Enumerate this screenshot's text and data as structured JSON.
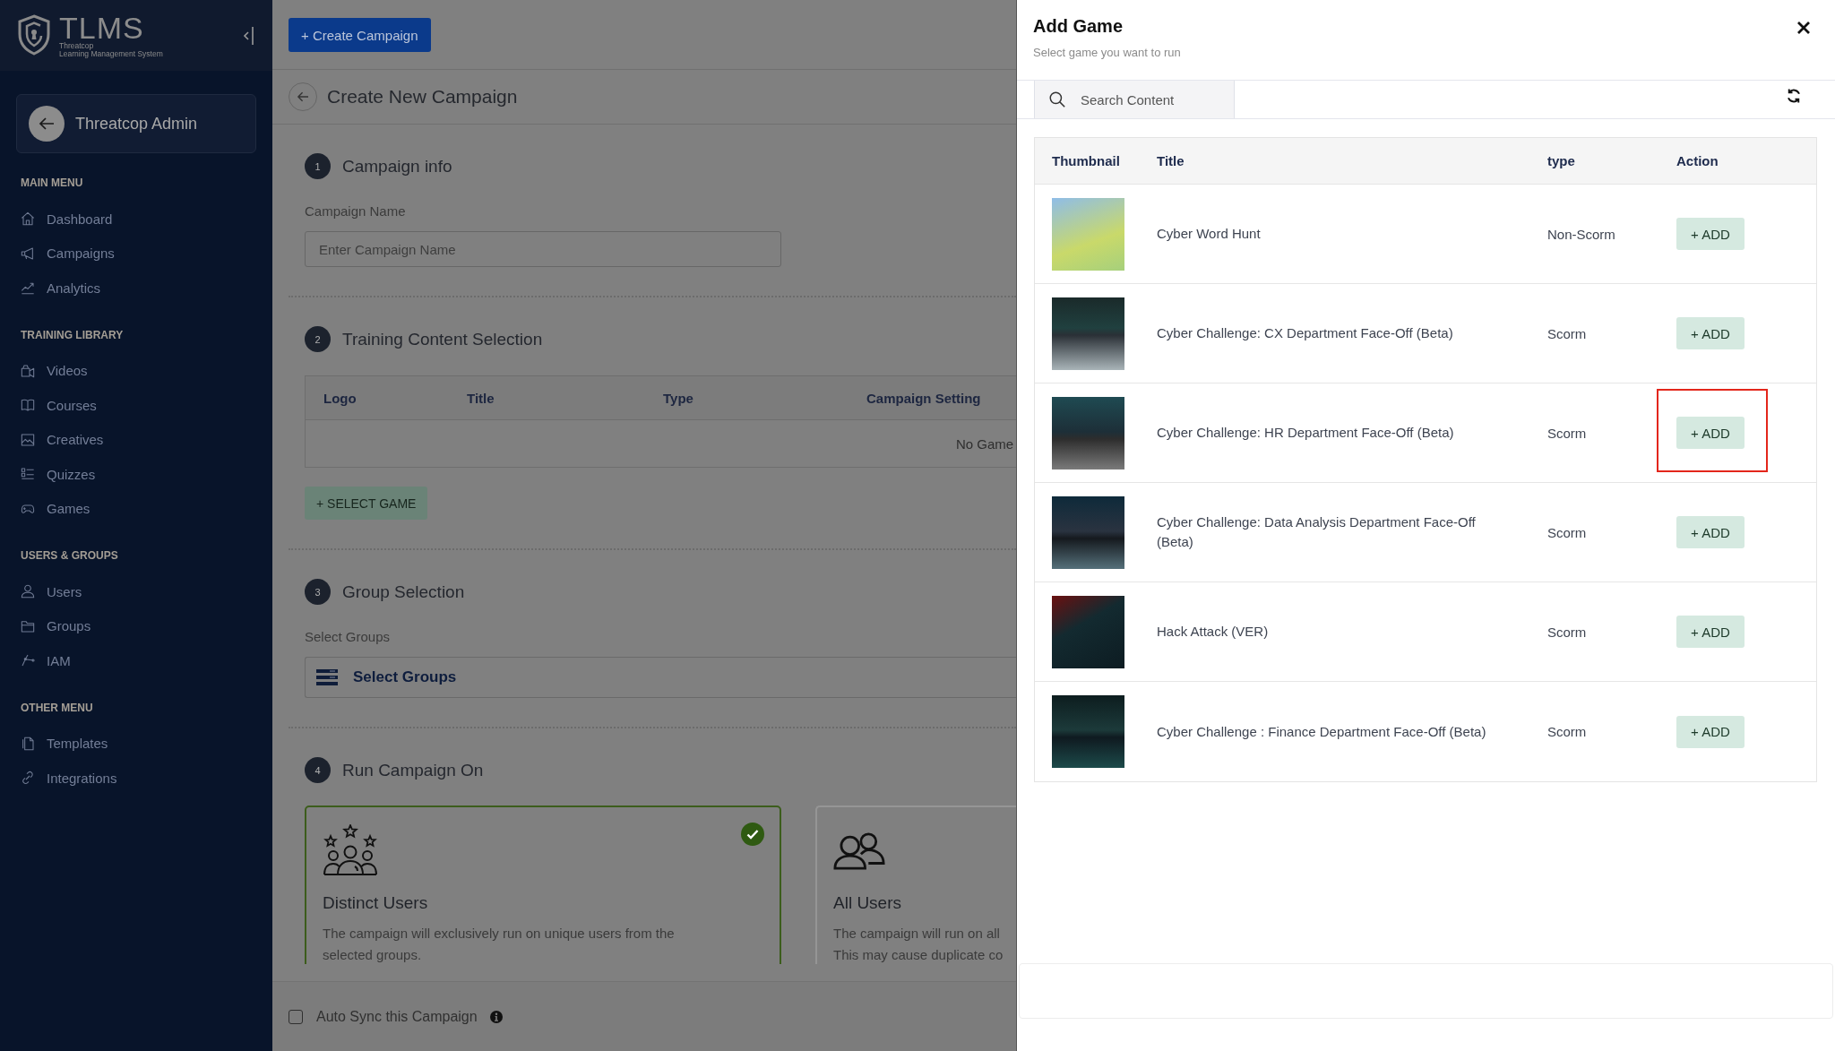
{
  "sidebar": {
    "logo": {
      "name": "TLMS",
      "tagline": [
        "Threatcop",
        "Learning Management System"
      ]
    },
    "account": {
      "name": "Threatcop Admin"
    },
    "sections": [
      {
        "heading": "MAIN MENU",
        "items": [
          {
            "label": "Dashboard"
          },
          {
            "label": "Campaigns"
          },
          {
            "label": "Analytics"
          }
        ]
      },
      {
        "heading": "TRAINING LIBRARY",
        "items": [
          {
            "label": "Videos"
          },
          {
            "label": "Courses"
          },
          {
            "label": "Creatives"
          },
          {
            "label": "Quizzes"
          },
          {
            "label": "Games"
          }
        ]
      },
      {
        "heading": "USERS & GROUPS",
        "items": [
          {
            "label": "Users"
          },
          {
            "label": "Groups"
          },
          {
            "label": "IAM"
          }
        ]
      },
      {
        "heading": "OTHER MENU",
        "items": [
          {
            "label": "Templates"
          },
          {
            "label": "Integrations"
          }
        ]
      }
    ]
  },
  "toolbar": {
    "create_button": "+ Create Campaign"
  },
  "page": {
    "title": "Create New Campaign"
  },
  "steps": [
    {
      "number": "1",
      "kind": "name",
      "title": "Campaign info",
      "field_label": "Campaign Name",
      "placeholder": "Enter Campaign Name"
    },
    {
      "number": "2",
      "kind": "content",
      "title": "Training Content Selection",
      "columns": [
        "Logo",
        "Title",
        "Type",
        "Campaign Setting"
      ],
      "empty_text": "No Game",
      "button": "+ SELECT GAME"
    },
    {
      "number": "3",
      "kind": "groups",
      "title": "Group Selection",
      "field_label": "Select Groups",
      "trigger_label": "Select Groups"
    },
    {
      "number": "4",
      "kind": "run_on",
      "title": "Run Campaign On",
      "options": [
        {
          "title": "Distinct Users",
          "description": "The campaign will exclusively run on unique users from the selected groups.",
          "selected": true
        },
        {
          "title": "All Users",
          "description": "The campaign will run on all\nThis may cause duplicate co",
          "selected": false
        }
      ]
    }
  ],
  "footer": {
    "auto_sync": {
      "label": "Auto Sync this Campaign",
      "checked": false
    }
  },
  "drawer": {
    "title": "Add Game",
    "subtitle": "Select game you want to run",
    "search": {
      "placeholder": "Search Content"
    },
    "columns": [
      "Thumbnail",
      "Title",
      "type",
      "Action"
    ],
    "rows": [
      {
        "title": "Cyber Word Hunt",
        "type": "Non-Scorm",
        "action": "+ ADD",
        "highlighted": false
      },
      {
        "title": "Cyber Challenge: CX Department Face-Off (Beta)",
        "type": "Scorm",
        "action": "+ ADD",
        "highlighted": false
      },
      {
        "title": "Cyber Challenge: HR Department Face-Off (Beta)",
        "type": "Scorm",
        "action": "+ ADD",
        "highlighted": true
      },
      {
        "title": "Cyber Challenge: Data Analysis Department Face-Off (Beta)",
        "type": "Scorm",
        "action": "+ ADD",
        "highlighted": false
      },
      {
        "title": "Hack Attack (VER)",
        "type": "Scorm",
        "action": "+ ADD",
        "highlighted": false
      },
      {
        "title": "Cyber Challenge : Finance Department Face-Off (Beta)",
        "type": "Scorm",
        "action": "+ ADD",
        "highlighted": false
      }
    ]
  }
}
